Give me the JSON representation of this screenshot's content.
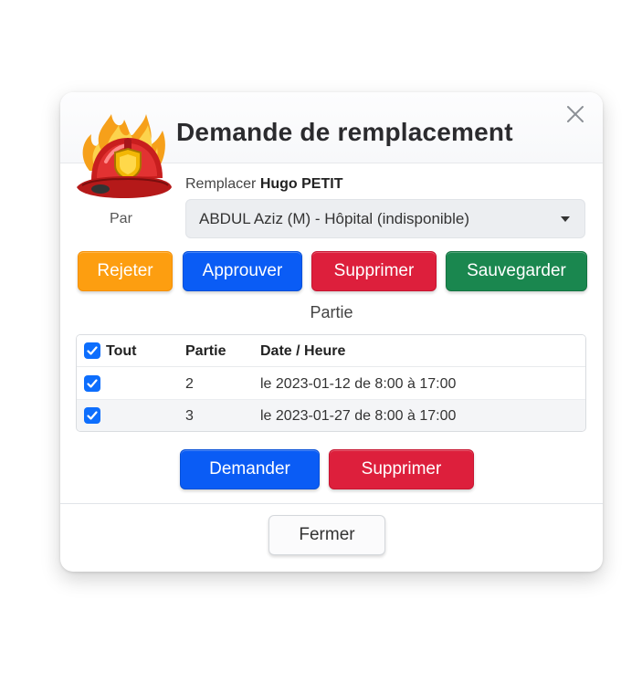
{
  "modal": {
    "title": "Demande de remplacement",
    "replace_prefix": "Remplacer",
    "replace_name": "Hugo PETIT",
    "par_label": "Par",
    "selected_replacement": "ABDUL Aziz (M)  - Hôpital (indisponible)"
  },
  "actions": {
    "reject_label": "Rejeter",
    "approve_label": "Approuver",
    "delete_label": "Supprimer",
    "save_label": "Sauvegarder"
  },
  "parts": {
    "section_title": "Partie",
    "columns": [
      "Tout",
      "Partie",
      "Date / Heure"
    ],
    "rows": [
      {
        "checked": true,
        "partie": "2",
        "date": "le 2023-01-12 de 8:00 à 17:00"
      },
      {
        "checked": true,
        "partie": "3",
        "date": "le 2023-01-27 de 8:00 à 17:00"
      }
    ],
    "request_label": "Demander",
    "delete_label": "Supprimer"
  },
  "footer": {
    "close_label": "Fermer"
  },
  "colors": {
    "orange": "#fd9e10",
    "blue": "#0a5cf5",
    "red": "#dd1f3c",
    "green": "#1a874f",
    "checkbox": "#0d6efd"
  },
  "icons": [
    "firefighter-helmet-logo",
    "close-icon",
    "chevron-down-icon",
    "checkbox-checked-icon"
  ]
}
